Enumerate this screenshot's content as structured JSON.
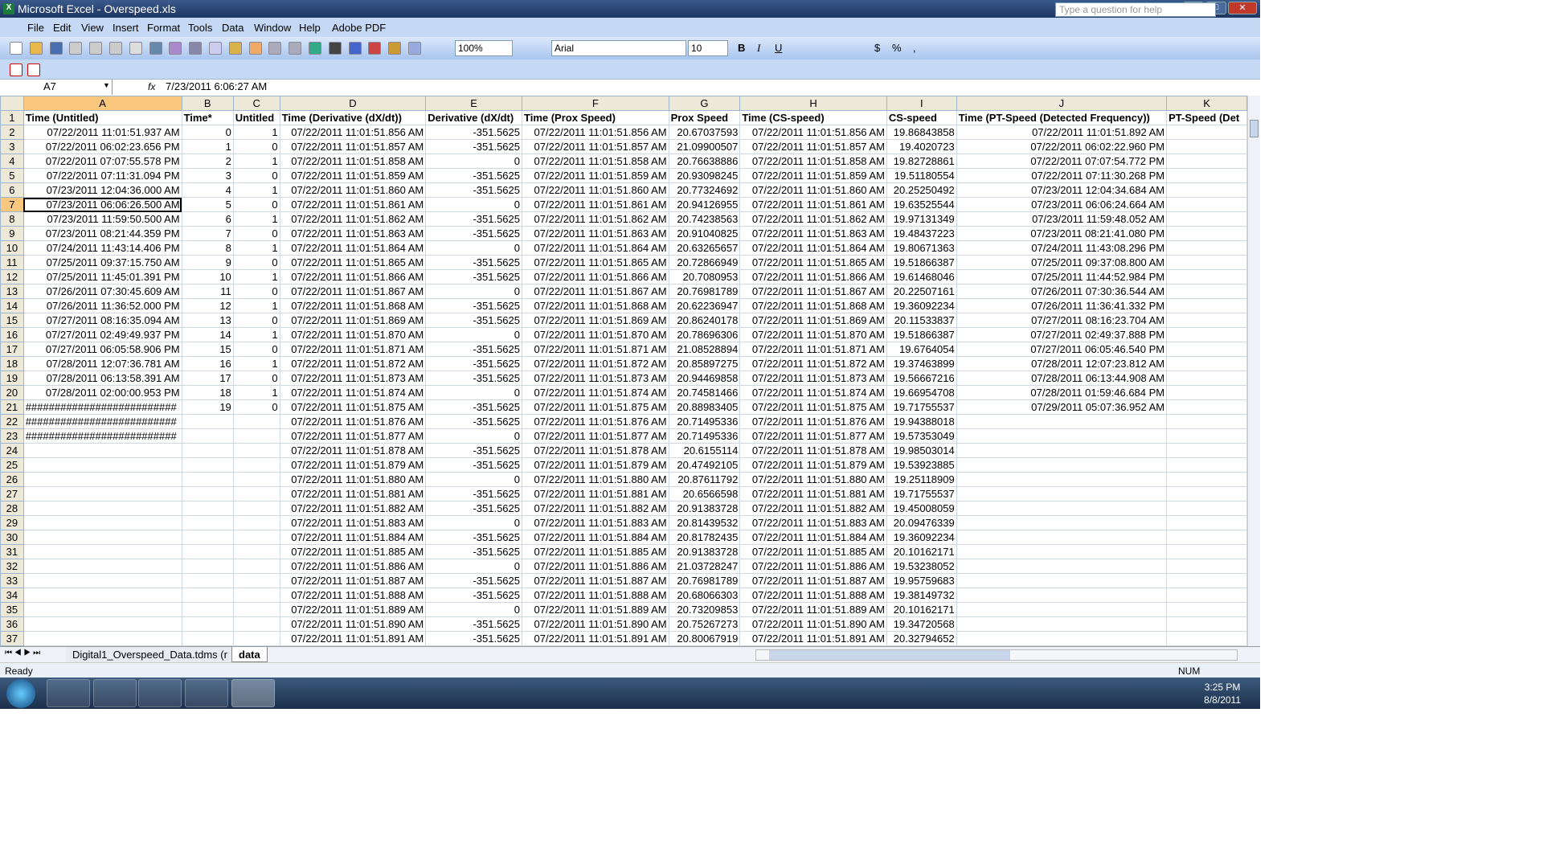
{
  "window": {
    "title": "Microsoft Excel - Overspeed.xls"
  },
  "menu": [
    "File",
    "Edit",
    "View",
    "Insert",
    "Format",
    "Tools",
    "Data",
    "Window",
    "Help",
    "Adobe PDF"
  ],
  "help_placeholder": "Type a question for help",
  "toolbar": {
    "zoom": "100%",
    "font": "Arial",
    "size": "10",
    "bold": "B",
    "italic": "I",
    "underline": "U",
    "currency": "$",
    "percent": "%",
    "comma": ","
  },
  "formula_bar": {
    "name_box": "A7",
    "fx": "fx",
    "value": "7/23/2011  6:06:27 AM"
  },
  "columns": [
    "A",
    "B",
    "C",
    "D",
    "E",
    "F",
    "G",
    "H",
    "I",
    "J",
    "K"
  ],
  "selected_cell": {
    "col": "A",
    "row": 7
  },
  "rows": [
    [
      "Time (Untitled)",
      "Time*",
      "Untitled",
      "Time (Derivative (dX/dt))",
      "Derivative (dX/dt)",
      "Time (Prox Speed)",
      "Prox Speed",
      "Time (CS-speed)",
      "CS-speed",
      "Time (PT-Speed (Detected Frequency))",
      "PT-Speed (Det"
    ],
    [
      "07/22/2011 11:01:51.937 AM",
      "0",
      "1",
      "07/22/2011 11:01:51.856 AM",
      "-351.5625",
      "07/22/2011 11:01:51.856 AM",
      "20.67037593",
      "07/22/2011 11:01:51.856 AM",
      "19.86843858",
      "07/22/2011 11:01:51.892 AM",
      ""
    ],
    [
      "07/22/2011 06:02:23.656 PM",
      "1",
      "0",
      "07/22/2011 11:01:51.857 AM",
      "-351.5625",
      "07/22/2011 11:01:51.857 AM",
      "21.09900507",
      "07/22/2011 11:01:51.857 AM",
      "19.4020723",
      "07/22/2011 06:02:22.960 PM",
      ""
    ],
    [
      "07/22/2011 07:07:55.578 PM",
      "2",
      "1",
      "07/22/2011 11:01:51.858 AM",
      "0",
      "07/22/2011 11:01:51.858 AM",
      "20.76638886",
      "07/22/2011 11:01:51.858 AM",
      "19.82728861",
      "07/22/2011 07:07:54.772 PM",
      ""
    ],
    [
      "07/22/2011 07:11:31.094 PM",
      "3",
      "0",
      "07/22/2011 11:01:51.859 AM",
      "-351.5625",
      "07/22/2011 11:01:51.859 AM",
      "20.93098245",
      "07/22/2011 11:01:51.859 AM",
      "19.51180554",
      "07/22/2011 07:11:30.268 PM",
      ""
    ],
    [
      "07/23/2011 12:04:36.000 AM",
      "4",
      "1",
      "07/22/2011 11:01:51.860 AM",
      "-351.5625",
      "07/22/2011 11:01:51.860 AM",
      "20.77324692",
      "07/22/2011 11:01:51.860 AM",
      "20.25250492",
      "07/23/2011 12:04:34.684 AM",
      ""
    ],
    [
      "07/23/2011 06:06:26.500 AM",
      "5",
      "0",
      "07/22/2011 11:01:51.861 AM",
      "0",
      "07/22/2011 11:01:51.861 AM",
      "20.94126955",
      "07/22/2011 11:01:51.861 AM",
      "19.63525544",
      "07/23/2011 06:06:24.664 AM",
      ""
    ],
    [
      "07/23/2011 11:59:50.500 AM",
      "6",
      "1",
      "07/22/2011 11:01:51.862 AM",
      "-351.5625",
      "07/22/2011 11:01:51.862 AM",
      "20.74238563",
      "07/22/2011 11:01:51.862 AM",
      "19.97131349",
      "07/23/2011 11:59:48.052 AM",
      ""
    ],
    [
      "07/23/2011 08:21:44.359 PM",
      "7",
      "0",
      "07/22/2011 11:01:51.863 AM",
      "-351.5625",
      "07/22/2011 11:01:51.863 AM",
      "20.91040825",
      "07/22/2011 11:01:51.863 AM",
      "19.48437223",
      "07/23/2011 08:21:41.080 PM",
      ""
    ],
    [
      "07/24/2011 11:43:14.406 PM",
      "8",
      "1",
      "07/22/2011 11:01:51.864 AM",
      "0",
      "07/22/2011 11:01:51.864 AM",
      "20.63265657",
      "07/22/2011 11:01:51.864 AM",
      "19.80671363",
      "07/24/2011 11:43:08.296 PM",
      ""
    ],
    [
      "07/25/2011 09:37:15.750 AM",
      "9",
      "0",
      "07/22/2011 11:01:51.865 AM",
      "-351.5625",
      "07/22/2011 11:01:51.865 AM",
      "20.72866949",
      "07/22/2011 11:01:51.865 AM",
      "19.51866387",
      "07/25/2011 09:37:08.800 AM",
      ""
    ],
    [
      "07/25/2011 11:45:01.391 PM",
      "10",
      "1",
      "07/22/2011 11:01:51.866 AM",
      "-351.5625",
      "07/22/2011 11:01:51.866 AM",
      "20.7080953",
      "07/22/2011 11:01:51.866 AM",
      "19.61468046",
      "07/25/2011 11:44:52.984 PM",
      ""
    ],
    [
      "07/26/2011 07:30:45.609 AM",
      "11",
      "0",
      "07/22/2011 11:01:51.867 AM",
      "0",
      "07/22/2011 11:01:51.867 AM",
      "20.76981789",
      "07/22/2011 11:01:51.867 AM",
      "20.22507161",
      "07/26/2011 07:30:36.544 AM",
      ""
    ],
    [
      "07/26/2011 11:36:52.000 PM",
      "12",
      "1",
      "07/22/2011 11:01:51.868 AM",
      "-351.5625",
      "07/22/2011 11:01:51.868 AM",
      "20.62236947",
      "07/22/2011 11:01:51.868 AM",
      "19.36092234",
      "07/26/2011 11:36:41.332 PM",
      ""
    ],
    [
      "07/27/2011 08:16:35.094 AM",
      "13",
      "0",
      "07/22/2011 11:01:51.869 AM",
      "-351.5625",
      "07/22/2011 11:01:51.869 AM",
      "20.86240178",
      "07/22/2011 11:01:51.869 AM",
      "20.11533837",
      "07/27/2011 08:16:23.704 AM",
      ""
    ],
    [
      "07/27/2011 02:49:49.937 PM",
      "14",
      "1",
      "07/22/2011 11:01:51.870 AM",
      "0",
      "07/22/2011 11:01:51.870 AM",
      "20.78696306",
      "07/22/2011 11:01:51.870 AM",
      "19.51866387",
      "07/27/2011 02:49:37.888 PM",
      ""
    ],
    [
      "07/27/2011 06:05:58.906 PM",
      "15",
      "0",
      "07/22/2011 11:01:51.871 AM",
      "-351.5625",
      "07/22/2011 11:01:51.871 AM",
      "21.08528894",
      "07/22/2011 11:01:51.871 AM",
      "19.6764054",
      "07/27/2011 06:05:46.540 PM",
      ""
    ],
    [
      "07/28/2011 12:07:36.781 AM",
      "16",
      "1",
      "07/22/2011 11:01:51.872 AM",
      "-351.5625",
      "07/22/2011 11:01:51.872 AM",
      "20.85897275",
      "07/22/2011 11:01:51.872 AM",
      "19.37463899",
      "07/28/2011 12:07:23.812 AM",
      ""
    ],
    [
      "07/28/2011 06:13:58.391 AM",
      "17",
      "0",
      "07/22/2011 11:01:51.873 AM",
      "-351.5625",
      "07/22/2011 11:01:51.873 AM",
      "20.94469858",
      "07/22/2011 11:01:51.873 AM",
      "19.56667216",
      "07/28/2011 06:13:44.908 AM",
      ""
    ],
    [
      "07/28/2011 02:00:00.953 PM",
      "18",
      "1",
      "07/22/2011 11:01:51.874 AM",
      "0",
      "07/22/2011 11:01:51.874 AM",
      "20.74581466",
      "07/22/2011 11:01:51.874 AM",
      "19.66954708",
      "07/28/2011 01:59:46.684 PM",
      ""
    ],
    [
      "##########################",
      "19",
      "0",
      "07/22/2011 11:01:51.875 AM",
      "-351.5625",
      "07/22/2011 11:01:51.875 AM",
      "20.88983405",
      "07/22/2011 11:01:51.875 AM",
      "19.71755537",
      "07/29/2011 05:07:36.952 AM",
      ""
    ],
    [
      "##########################",
      "",
      "",
      "07/22/2011 11:01:51.876 AM",
      "-351.5625",
      "07/22/2011 11:01:51.876 AM",
      "20.71495336",
      "07/22/2011 11:01:51.876 AM",
      "19.94388018",
      "",
      ""
    ],
    [
      "##########################",
      "",
      "",
      "07/22/2011 11:01:51.877 AM",
      "0",
      "07/22/2011 11:01:51.877 AM",
      "20.71495336",
      "07/22/2011 11:01:51.877 AM",
      "19.57353049",
      "",
      ""
    ],
    [
      "",
      "",
      "",
      "07/22/2011 11:01:51.878 AM",
      "-351.5625",
      "07/22/2011 11:01:51.878 AM",
      "20.6155114",
      "07/22/2011 11:01:51.878 AM",
      "19.98503014",
      "",
      ""
    ],
    [
      "",
      "",
      "",
      "07/22/2011 11:01:51.879 AM",
      "-351.5625",
      "07/22/2011 11:01:51.879 AM",
      "20.47492105",
      "07/22/2011 11:01:51.879 AM",
      "19.53923885",
      "",
      ""
    ],
    [
      "",
      "",
      "",
      "07/22/2011 11:01:51.880 AM",
      "0",
      "07/22/2011 11:01:51.880 AM",
      "20.87611792",
      "07/22/2011 11:01:51.880 AM",
      "19.25118909",
      "",
      ""
    ],
    [
      "",
      "",
      "",
      "07/22/2011 11:01:51.881 AM",
      "-351.5625",
      "07/22/2011 11:01:51.881 AM",
      "20.6566598",
      "07/22/2011 11:01:51.881 AM",
      "19.71755537",
      "",
      ""
    ],
    [
      "",
      "",
      "",
      "07/22/2011 11:01:51.882 AM",
      "-351.5625",
      "07/22/2011 11:01:51.882 AM",
      "20.91383728",
      "07/22/2011 11:01:51.882 AM",
      "19.45008059",
      "",
      ""
    ],
    [
      "",
      "",
      "",
      "07/22/2011 11:01:51.883 AM",
      "0",
      "07/22/2011 11:01:51.883 AM",
      "20.81439532",
      "07/22/2011 11:01:51.883 AM",
      "20.09476339",
      "",
      ""
    ],
    [
      "",
      "",
      "",
      "07/22/2011 11:01:51.884 AM",
      "-351.5625",
      "07/22/2011 11:01:51.884 AM",
      "20.81782435",
      "07/22/2011 11:01:51.884 AM",
      "19.36092234",
      "",
      ""
    ],
    [
      "",
      "",
      "",
      "07/22/2011 11:01:51.885 AM",
      "-351.5625",
      "07/22/2011 11:01:51.885 AM",
      "20.91383728",
      "07/22/2011 11:01:51.885 AM",
      "20.10162171",
      "",
      ""
    ],
    [
      "",
      "",
      "",
      "07/22/2011 11:01:51.886 AM",
      "0",
      "07/22/2011 11:01:51.886 AM",
      "21.03728247",
      "07/22/2011 11:01:51.886 AM",
      "19.53238052",
      "",
      ""
    ],
    [
      "",
      "",
      "",
      "07/22/2011 11:01:51.887 AM",
      "-351.5625",
      "07/22/2011 11:01:51.887 AM",
      "20.76981789",
      "07/22/2011 11:01:51.887 AM",
      "19.95759683",
      "",
      ""
    ],
    [
      "",
      "",
      "",
      "07/22/2011 11:01:51.888 AM",
      "-351.5625",
      "07/22/2011 11:01:51.888 AM",
      "20.68066303",
      "07/22/2011 11:01:51.888 AM",
      "19.38149732",
      "",
      ""
    ],
    [
      "",
      "",
      "",
      "07/22/2011 11:01:51.889 AM",
      "0",
      "07/22/2011 11:01:51.889 AM",
      "20.73209853",
      "07/22/2011 11:01:51.889 AM",
      "20.10162171",
      "",
      ""
    ],
    [
      "",
      "",
      "",
      "07/22/2011 11:01:51.890 AM",
      "-351.5625",
      "07/22/2011 11:01:51.890 AM",
      "20.75267273",
      "07/22/2011 11:01:51.890 AM",
      "19.34720568",
      "",
      ""
    ],
    [
      "",
      "",
      "",
      "07/22/2011 11:01:51.891 AM",
      "-351.5625",
      "07/22/2011 11:01:51.891 AM",
      "20.80067919",
      "07/22/2011 11:01:51.891 AM",
      "20.32794652",
      "",
      ""
    ]
  ],
  "sheet_tabs": [
    "Digital1_Overspeed_Data.tdms (r",
    "data"
  ],
  "active_tab": "data",
  "status": {
    "left": "Ready",
    "num": "NUM"
  },
  "taskbar": {
    "time": "3:25 PM",
    "date": "8/8/2011"
  },
  "colors": {
    "accent": "#f9c77d",
    "title_bar": "#1e3560",
    "menubar": "#c5d9f5"
  }
}
